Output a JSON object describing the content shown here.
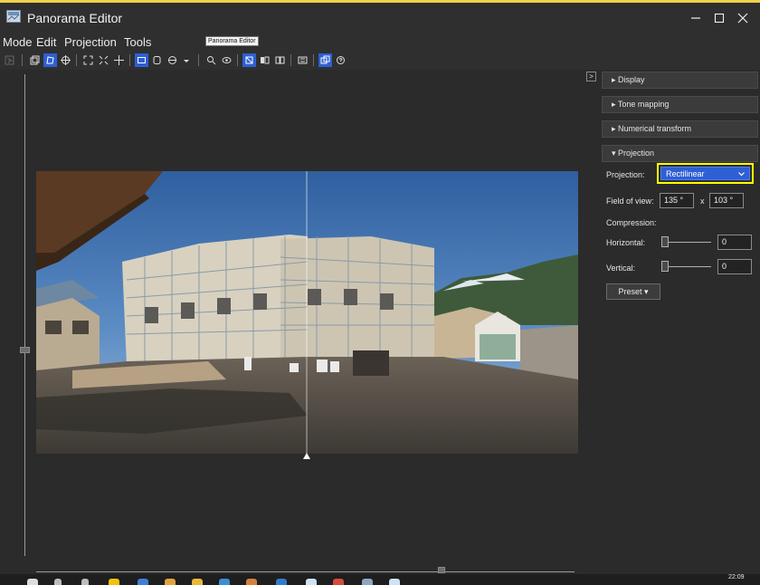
{
  "window": {
    "title": "Panorama Editor",
    "app_icon": "panorama-editor-icon"
  },
  "window_controls": {
    "minimize_icon": "minimize-icon",
    "maximize_icon": "maximize-icon",
    "close_icon": "close-icon"
  },
  "menu": {
    "items": [
      "Mode",
      "Edit",
      "Projection",
      "Tools"
    ]
  },
  "tooltip": {
    "text": "Panorama Editor"
  },
  "toolbar": {
    "icons": [
      "select-icon",
      "drag-mode-icon",
      "control-points-icon",
      "crop-icon",
      "fit-icon",
      "straighten-icon",
      "center-icon",
      "rectilinear-icon",
      "cylindrical-icon",
      "equirectangular-icon",
      "dropdown-icon",
      "zoom-icon",
      "preview-icon",
      "show-overlay-icon",
      "stereo-icon",
      "mosaic-icon",
      "numerical-icon",
      "panorama-window-icon",
      "help-icon"
    ],
    "active": [
      "control-points-icon",
      "rectilinear-icon",
      "show-overlay-icon",
      "panorama-window-icon"
    ]
  },
  "panel": {
    "collapse_label": ">",
    "sections": [
      {
        "label": "▸ Display"
      },
      {
        "label": "▸ Tone mapping"
      },
      {
        "label": "▸ Numerical transform"
      },
      {
        "label": "▾ Projection"
      }
    ],
    "projection": {
      "label": "Projection:",
      "selected": "Rectilinear",
      "fov_label": "Field of view:",
      "fov_h": "135 °",
      "fov_sep": "x",
      "fov_v": "103 °",
      "compression_label": "Compression:",
      "horizontal_label": "Horizontal:",
      "horizontal_value": "0",
      "vertical_label": "Vertical:",
      "vertical_value": "0",
      "preset_label": "Preset ▾"
    }
  },
  "taskbar": {
    "clock": "22:09"
  },
  "colors": {
    "accent": "#2e5fd4",
    "highlight": "#ffff00",
    "panel_bg": "#2b2b2b"
  }
}
